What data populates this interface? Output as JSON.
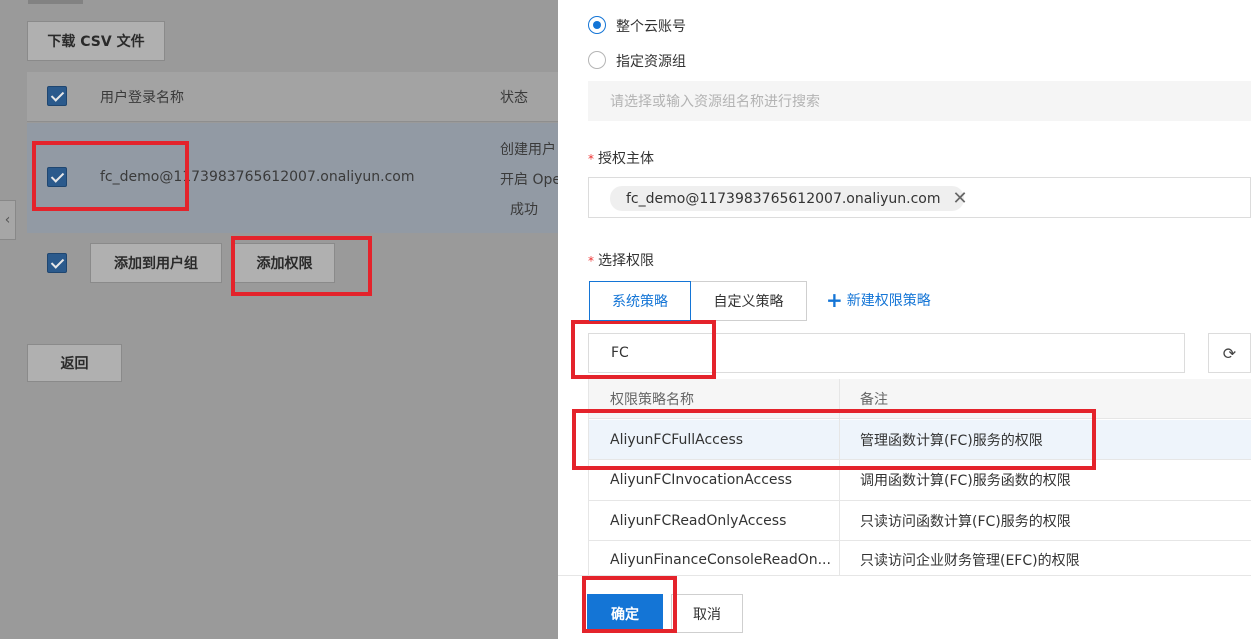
{
  "background": {
    "download_csv_label": "下载 CSV 文件",
    "table": {
      "col_username": "用户登录名称",
      "col_status": "状态",
      "row_username": "fc_demo@1173983765612007.onaliyun.com",
      "status_lines": [
        "创建用户",
        "开启 Ope",
        "成功"
      ]
    },
    "add_to_group_label": "添加到用户组",
    "add_permission_label": "添加权限",
    "back_label": "返回",
    "collapse_icon": "chevron-left-icon"
  },
  "drawer": {
    "scope": {
      "option_account": "整个云账号",
      "option_resource_group": "指定资源组",
      "resource_group_placeholder": "请选择或输入资源组名称进行搜索",
      "selected": "account"
    },
    "principal": {
      "label": "授权主体",
      "tag_text": "fc_demo@1173983765612007.onaliyun.com"
    },
    "permissions": {
      "label": "选择权限",
      "tab_system": "系统策略",
      "tab_custom": "自定义策略",
      "new_policy_label": "新建权限策略",
      "search_value": "FC",
      "col_name": "权限策略名称",
      "col_note": "备注",
      "rows": [
        {
          "name": "AliyunFCFullAccess",
          "note": "管理函数计算(FC)服务的权限"
        },
        {
          "name": "AliyunFCInvocationAccess",
          "note": "调用函数计算(FC)服务函数的权限"
        },
        {
          "name": "AliyunFCReadOnlyAccess",
          "note": "只读访问函数计算(FC)服务的权限"
        },
        {
          "name": "AliyunFinanceConsoleReadOn...",
          "note": "只读访问企业财务管理(EFC)的权限"
        }
      ]
    },
    "footer": {
      "confirm_label": "确定",
      "cancel_label": "取消"
    }
  },
  "colors": {
    "accent": "#1475d6",
    "highlight": "#e4232b",
    "overlay": "#9a9a9a"
  }
}
